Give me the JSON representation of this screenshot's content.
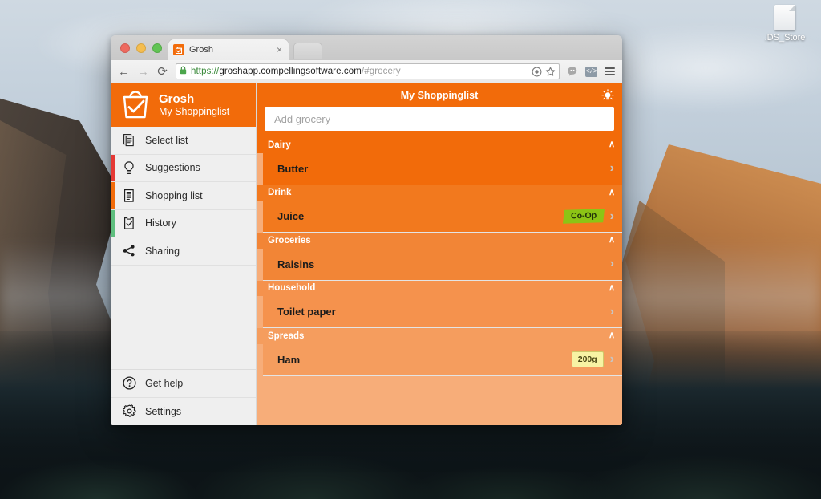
{
  "desktop": {
    "file_icon_label": ".DS_Store"
  },
  "browser": {
    "tab": {
      "title": "Grosh",
      "favicon_name": "grosh-bag-check-icon",
      "close_label": "×"
    },
    "new_tab_label": "",
    "toolbar": {
      "back_label": "←",
      "forward_label": "→",
      "reload_label": "⟳",
      "lock_icon": "padlock-icon",
      "url_scheme": "https://",
      "url_host": "groshapp.compellingsoftware.com",
      "url_path": "/#grocery",
      "icons": [
        {
          "name": "target-circle-icon"
        },
        {
          "name": "bookmark-star-icon"
        },
        {
          "name": "hangouts-icon"
        },
        {
          "name": "code-extension-icon",
          "label": "</>"
        },
        {
          "name": "chrome-menu-icon"
        }
      ]
    }
  },
  "app": {
    "brand": {
      "name": "Grosh",
      "subtitle": "My Shoppinglist",
      "logo_icon": "shopping-bag-check-icon"
    },
    "sidebar": {
      "items": [
        {
          "label": "Select list",
          "icon": "documents-stack-icon",
          "accent": "transparent"
        },
        {
          "label": "Suggestions",
          "icon": "lightbulb-icon",
          "accent": "#e53935"
        },
        {
          "label": "Shopping list",
          "icon": "list-document-icon",
          "accent": "#f26b0a"
        },
        {
          "label": "History",
          "icon": "clipboard-check-icon",
          "accent": "#5fbf7f"
        },
        {
          "label": "Sharing",
          "icon": "share-nodes-icon",
          "accent": "transparent"
        }
      ],
      "bottom_items": [
        {
          "label": "Get help",
          "icon": "question-circle-icon"
        },
        {
          "label": "Settings",
          "icon": "gear-icon"
        }
      ]
    },
    "main": {
      "title": "My Shoppinglist",
      "bulb_icon": "lightbulb-idea-icon",
      "add_input_placeholder": "Add grocery",
      "add_input_value": "",
      "collapse_chevron": "∧",
      "row_chevron": "›",
      "sections": [
        {
          "title": "Dairy",
          "color": "#f26b0a",
          "items": [
            {
              "name": "Butter",
              "shop": "",
              "amount": ""
            }
          ]
        },
        {
          "title": "Drink",
          "color": "#f2791e",
          "items": [
            {
              "name": "Juice",
              "shop": "Co-Op",
              "amount": ""
            }
          ]
        },
        {
          "title": "Groceries",
          "color": "#f28536",
          "items": [
            {
              "name": "Raisins",
              "shop": "",
              "amount": ""
            }
          ]
        },
        {
          "title": "Household",
          "color": "#f5924d",
          "items": [
            {
              "name": "Toilet paper",
              "shop": "",
              "amount": ""
            }
          ]
        },
        {
          "title": "Spreads",
          "color": "#f59d5e",
          "items": [
            {
              "name": "Ham",
              "shop": "",
              "amount": "200g"
            }
          ]
        }
      ]
    }
  },
  "colors": {
    "brand_orange": "#f26b0a",
    "panel_peach": "#f7ad79",
    "badge_green": "#8cc415",
    "badge_yellow": "#f7f3a4"
  }
}
